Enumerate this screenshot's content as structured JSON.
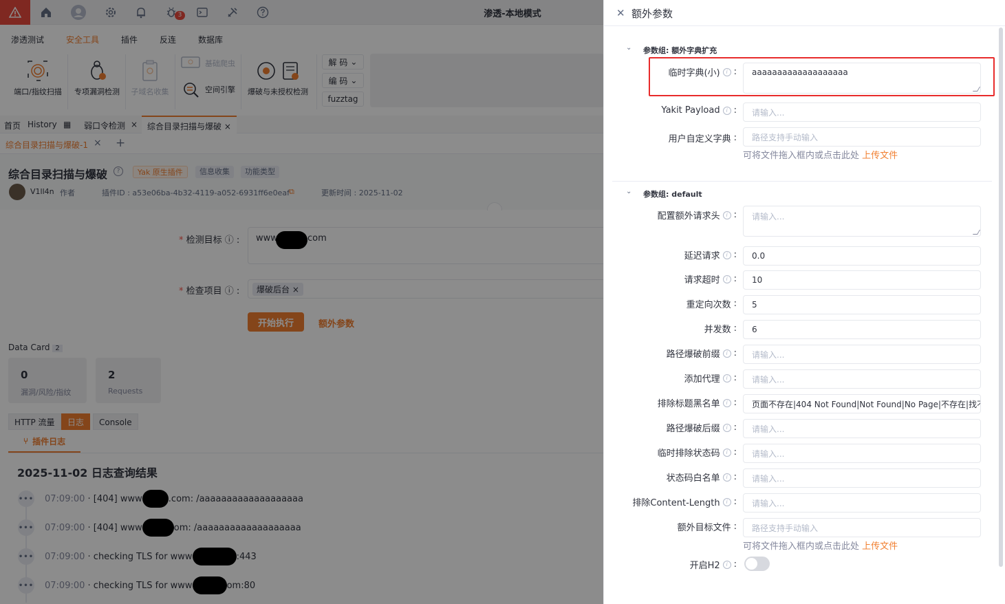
{
  "window": {
    "title": "渗透-本地模式",
    "bug_badge": "3"
  },
  "menu": [
    "渗透测试",
    "安全工具",
    "插件",
    "反连",
    "数据库"
  ],
  "tools": {
    "port_scan": "端口/指纹扫描",
    "vuln_check": "专项漏洞检测",
    "subdomain": "子域名收集",
    "crawler": "基础爬虫",
    "space_engine": "空间引擎",
    "brute": "爆破与未授权检测",
    "decode": "解 码",
    "encode": "编 码",
    "fuzztag": "fuzztag"
  },
  "tabs": [
    "首页",
    "History",
    "弱口令检测",
    "综合目录扫描与爆破"
  ],
  "subtab": "综合目录扫描与爆破-1",
  "plugin": {
    "title": "综合目录扫描与爆破",
    "tags": [
      "Yak 原生插件",
      "信息收集",
      "功能类型"
    ],
    "author": "V1ll4n",
    "author_role": "作者",
    "plugin_id": "插件ID : a53e06ba-4b32-4119-a052-6931ff6e0eaf",
    "updated": "更新时间 : 2025-11-02"
  },
  "form": {
    "target_label": "检测目标",
    "target_prefix": "www",
    "target_suffix": "com",
    "check_label": "检查项目",
    "check_tag": "爆破后台",
    "run_button": "开始执行",
    "extra_button": "额外参数"
  },
  "data_card": {
    "title": "Data Card",
    "count": "2",
    "cards": [
      {
        "value": "0",
        "label": "漏洞/风险/指纹"
      },
      {
        "value": "2",
        "label": "Requests"
      }
    ]
  },
  "result_tabs": [
    "HTTP 流量",
    "日志",
    "Console"
  ],
  "plugin_log_tab": "插件日志",
  "log": {
    "title": "2025-11-02 日志查询结果",
    "rows": [
      {
        "time": "07:09:00",
        "pre": "· [404] www",
        "post": ".com: /aaaaaaaaaaaaaaaaaaa"
      },
      {
        "time": "07:09:00",
        "pre": "· [404] www",
        "post": "om: /aaaaaaaaaaaaaaaaaaa"
      },
      {
        "time": "07:09:00",
        "pre": "· checking TLS for www",
        "post": ":443"
      },
      {
        "time": "07:09:00",
        "pre": "· checking TLS for www",
        "post": "om:80"
      }
    ]
  },
  "drawer": {
    "title": "额外参数",
    "group1": "参数组: 额外字典扩充",
    "temp_dict_label": "临时字典(小)",
    "temp_dict_value": "aaaaaaaaaaaaaaaaaaa",
    "yakit_payload_label": "Yakit Payload",
    "yakit_payload_placeholder": "请输入...",
    "user_dict_label": "用户自定义字典",
    "user_dict_placeholder": "路径支持手动输入",
    "upload_hint": "可将文件拖入框内或点击此处",
    "upload_link": "上传文件",
    "group2": "参数组: default",
    "fields": [
      {
        "label": "配置额外请求头",
        "info": true,
        "value": "",
        "placeholder": "请输入..."
      },
      {
        "label": "延迟请求",
        "info": true,
        "value": "0.0",
        "placeholder": ""
      },
      {
        "label": "请求超时",
        "info": true,
        "value": "10",
        "placeholder": ""
      },
      {
        "label": "重定向次数",
        "info": false,
        "value": "5",
        "placeholder": ""
      },
      {
        "label": "并发数",
        "info": false,
        "value": "6",
        "placeholder": ""
      },
      {
        "label": "路径爆破前缀",
        "info": true,
        "value": "",
        "placeholder": "请输入..."
      },
      {
        "label": "添加代理",
        "info": true,
        "value": "",
        "placeholder": "请输入..."
      },
      {
        "label": "排除标题黑名单",
        "info": true,
        "value": "页面不存在|404 Not Found|Not Found|No Page|不存在|找不",
        "placeholder": ""
      },
      {
        "label": "路径爆破后缀",
        "info": true,
        "value": "",
        "placeholder": "请输入..."
      },
      {
        "label": "临时排除状态码",
        "info": true,
        "value": "",
        "placeholder": "请输入..."
      },
      {
        "label": "状态码白名单",
        "info": true,
        "value": "",
        "placeholder": "请输入..."
      },
      {
        "label": "排除Content-Length",
        "info": true,
        "value": "",
        "placeholder": "请输入..."
      },
      {
        "label": "额外目标文件",
        "info": false,
        "value": "",
        "placeholder": "路径支持手动输入"
      }
    ],
    "upload_hint2": "可将文件拖入框内或点击此处",
    "upload_link2": "上传文件",
    "h2_label": "开启H2",
    "h2_enabled": false
  },
  "colors": {
    "accent": "#f17f30",
    "alert": "#e84a3d",
    "highlight": "#e82b2b"
  }
}
